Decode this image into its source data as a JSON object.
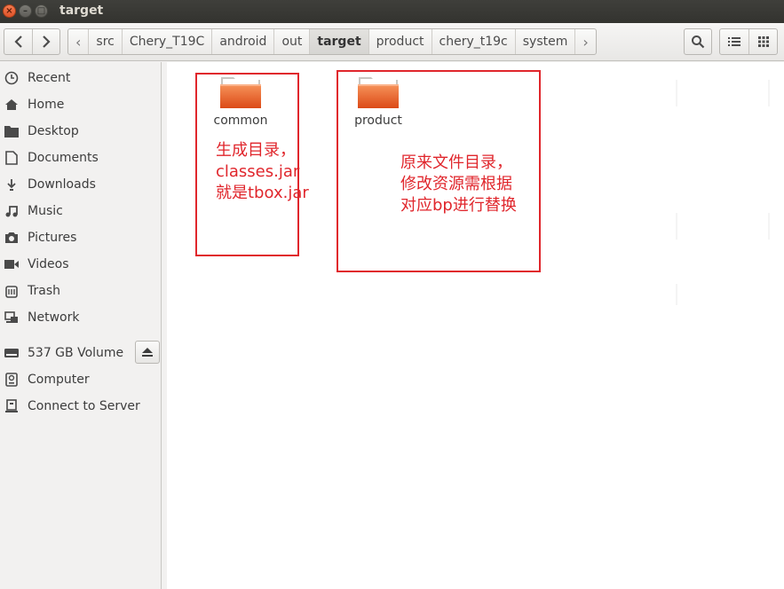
{
  "window": {
    "title": "target"
  },
  "toolbar": {
    "back_label": "‹",
    "forward_label": "›",
    "breadcrumbs": [
      "src",
      "Chery_T19C",
      "android",
      "out",
      "target",
      "product",
      "chery_t19c",
      "system"
    ],
    "active_crumb": "target",
    "crumb_left_arrow": "‹",
    "crumb_right_arrow": "›"
  },
  "sidebar": {
    "items": [
      {
        "label": "Recent",
        "icon": "clock-icon"
      },
      {
        "label": "Home",
        "icon": "home-icon"
      },
      {
        "label": "Desktop",
        "icon": "desktop-folder-icon"
      },
      {
        "label": "Documents",
        "icon": "document-icon"
      },
      {
        "label": "Downloads",
        "icon": "download-icon"
      },
      {
        "label": "Music",
        "icon": "music-icon"
      },
      {
        "label": "Pictures",
        "icon": "camera-icon"
      },
      {
        "label": "Videos",
        "icon": "video-icon"
      },
      {
        "label": "Trash",
        "icon": "trash-icon"
      },
      {
        "label": "Network",
        "icon": "network-icon"
      }
    ],
    "devices": [
      {
        "label": "537 GB Volume",
        "icon": "drive-icon"
      },
      {
        "label": "Computer",
        "icon": "computer-icon"
      },
      {
        "label": "Connect to Server",
        "icon": "server-icon"
      }
    ]
  },
  "content": {
    "folders": [
      {
        "name": "common"
      },
      {
        "name": "product"
      }
    ],
    "annotations": {
      "left": [
        "生成目录，",
        "classes.jar",
        "就是tbox.jar"
      ],
      "right": [
        "原来文件目录，",
        "修改资源需根据",
        "对应bp进行替换"
      ]
    }
  },
  "colors": {
    "annotation_red": "#e0262c",
    "folder_orange": "#f0703a",
    "titlebar": "#3b3b37"
  }
}
